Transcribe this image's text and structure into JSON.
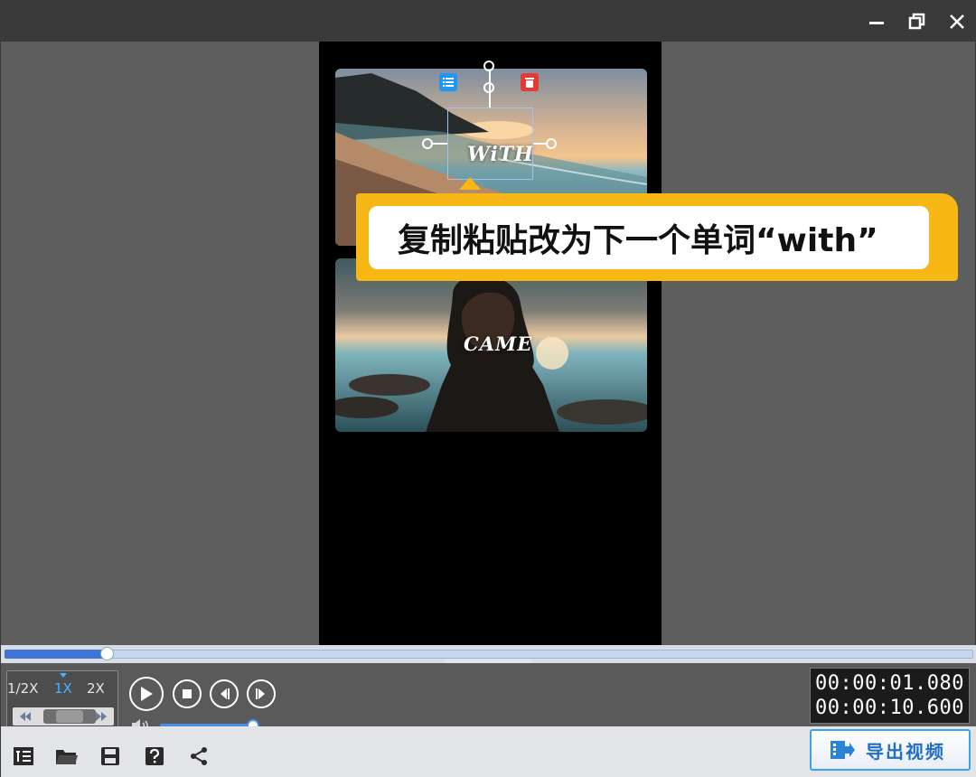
{
  "window": {
    "minimize_icon": "minimize-icon",
    "restore_icon": "restore-icon",
    "close_icon": "close-icon"
  },
  "preview": {
    "clip1_text": "WiTH",
    "clip2_text": "CAME"
  },
  "callout": {
    "text": "复制粘贴改为下一个单词“with”"
  },
  "playback": {
    "progress_fraction": 0.105,
    "speed_options": [
      "1/2X",
      "1X",
      "2X"
    ],
    "speed_selected": "1X",
    "current_time": "00:00:01.080",
    "total_time": "00:00:10.600",
    "volume_fraction": 1.0
  },
  "toolbar": {
    "export_label": "导出视频"
  },
  "colors": {
    "accent": "#3e74d6",
    "callout": "#f7b714",
    "delete_badge": "#e53935",
    "list_badge": "#2196f3"
  }
}
